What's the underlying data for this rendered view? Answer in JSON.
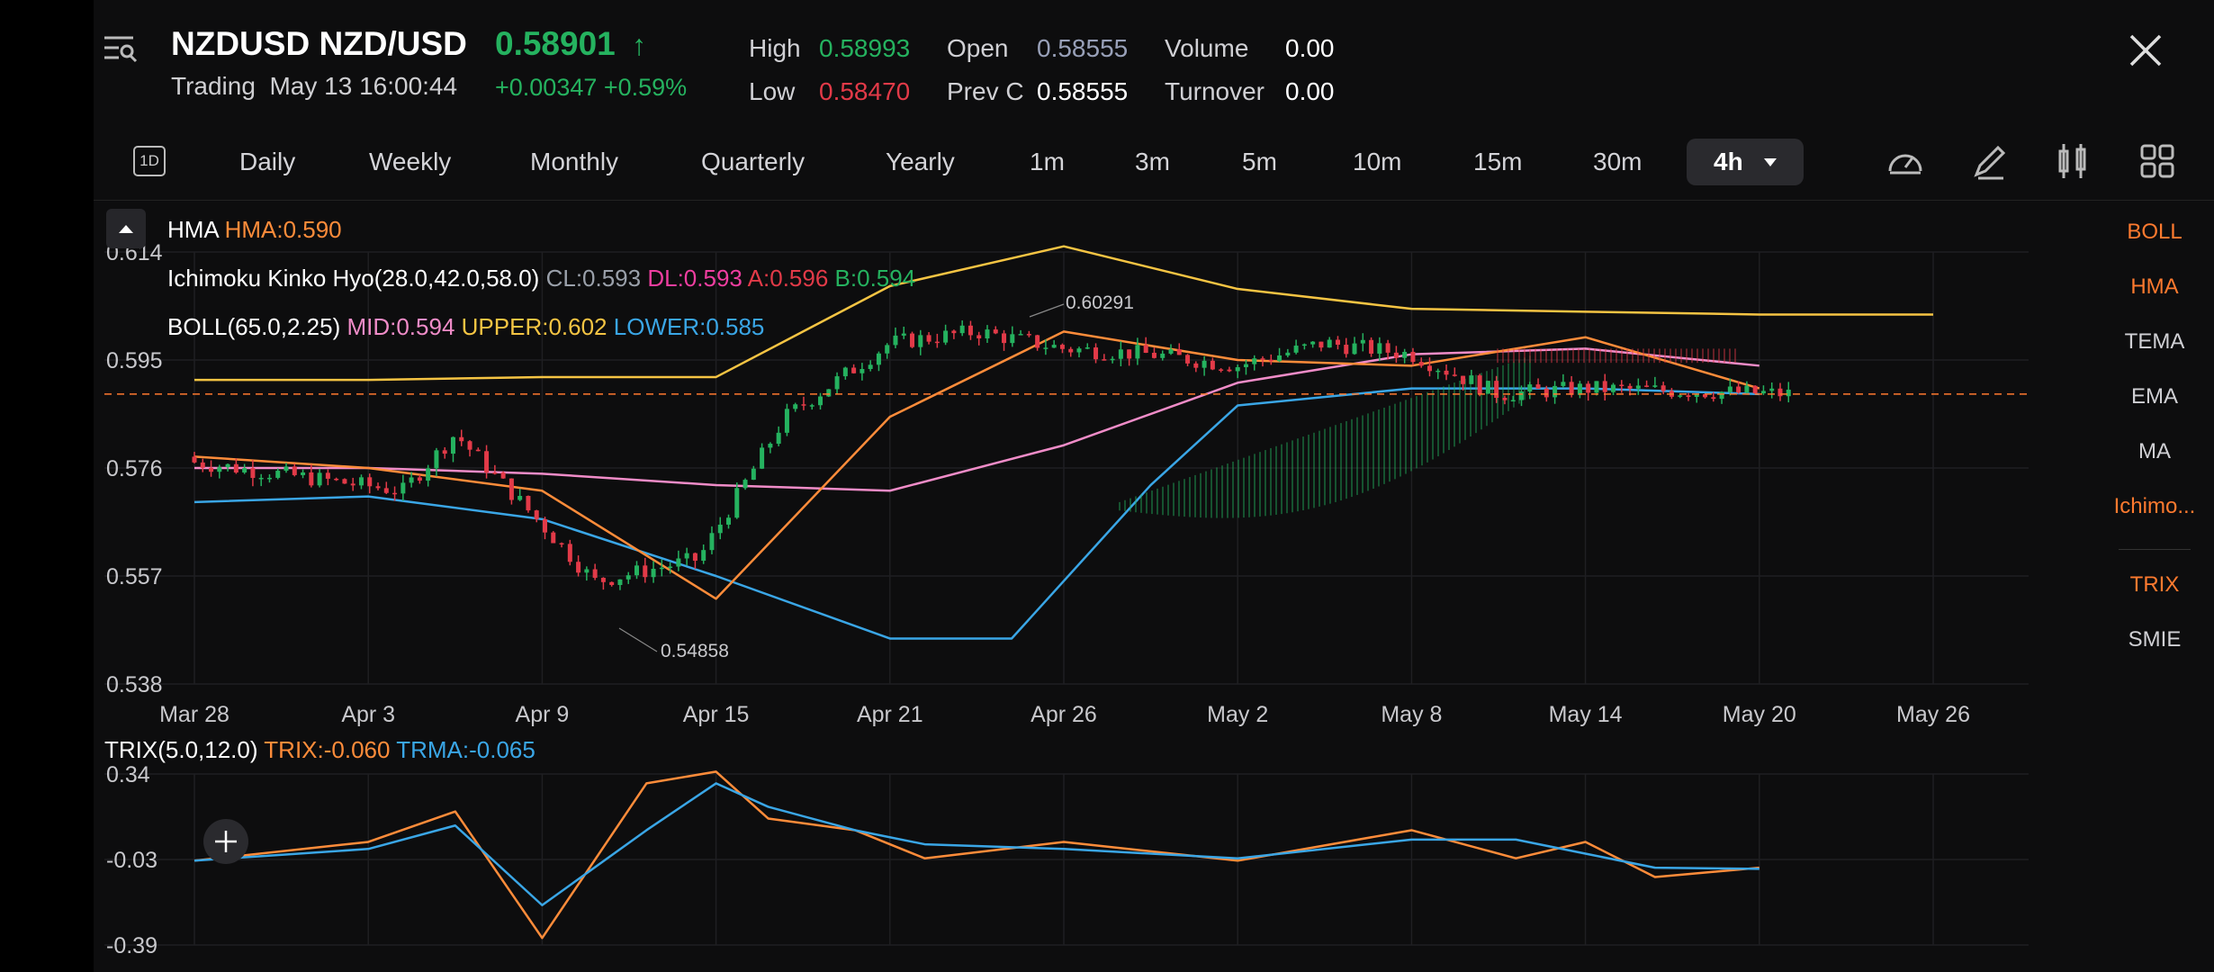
{
  "header": {
    "symbol": "NZDUSD NZD/USD",
    "price": "0.58901",
    "price_arrow": "↑",
    "status": "Trading",
    "timestamp": "May 13 16:00:44",
    "change": "+0.00347 +0.59%",
    "stats": {
      "high_label": "High",
      "high": "0.58993",
      "open_label": "Open",
      "open": "0.58555",
      "volume_label": "Volume",
      "volume": "0.00",
      "low_label": "Low",
      "low": "0.58470",
      "prevc_label": "Prev C",
      "prevc": "0.58555",
      "turnover_label": "Turnover",
      "turnover": "0.00"
    }
  },
  "tabs": {
    "icon_1d": "1D",
    "items": [
      "Daily",
      "Weekly",
      "Monthly",
      "Quarterly",
      "Yearly",
      "1m",
      "3m",
      "5m",
      "10m",
      "15m",
      "30m"
    ],
    "active": "4h"
  },
  "colors": {
    "up": "#25b25f",
    "down": "#e23a48",
    "accent": "#ff7a2f",
    "background": "#0d0d0e"
  },
  "icons": [
    "menu-search-icon",
    "close-icon",
    "chevron-up-icon",
    "speedometer-icon",
    "pencil-icon",
    "candlestick-icon",
    "grid-icon",
    "crosshair-icon"
  ],
  "legends": {
    "hma": {
      "name": "HMA",
      "value": "HMA:0.590"
    },
    "ichimoku": {
      "name": "Ichimoku Kinko Hyo(28.0,42.0,58.0)",
      "cl": "CL:0.593",
      "dl": "DL:0.593",
      "a": "A:0.596",
      "b": "B:0.594"
    },
    "boll": {
      "name": "BOLL(65.0,2.25)",
      "mid": "MID:0.594",
      "upper": "UPPER:0.602",
      "lower": "LOWER:0.585"
    },
    "trix": {
      "name": "TRIX(5.0,12.0)",
      "trix": "TRIX:-0.060",
      "trma": "TRMA:-0.065"
    }
  },
  "side_indicators": {
    "main": [
      "BOLL",
      "HMA",
      "TEMA",
      "EMA",
      "MA",
      "Ichimo..."
    ],
    "sub": [
      "TRIX",
      "SMIE"
    ],
    "active": [
      "BOLL",
      "HMA",
      "Ichimo...",
      "TRIX"
    ]
  },
  "chart_data": [
    {
      "type": "line",
      "title": "",
      "y_ticks": [
        "0.614",
        "0.595",
        "0.576",
        "0.557",
        "0.538"
      ],
      "ylim": [
        0.538,
        0.614
      ],
      "x_ticks": [
        "Mar 28",
        "Apr 3",
        "Apr 9",
        "Apr 15",
        "Apr 21",
        "Apr 26",
        "May 2",
        "May 8",
        "May 14",
        "May 20",
        "May 26"
      ],
      "annotations": [
        "0.60291",
        "0.54858"
      ],
      "current_price": 0.58901,
      "grid": true,
      "series": [
        {
          "name": "BOLL UPPER",
          "color": "#f5c443",
          "x": [
            0,
            1,
            2,
            3,
            4,
            5,
            6,
            7,
            8,
            9,
            10
          ],
          "values": [
            0.5915,
            0.5915,
            0.592,
            0.592,
            0.608,
            0.615,
            0.6075,
            0.604,
            0.6035,
            0.603,
            0.603
          ]
        },
        {
          "name": "BOLL LOWER",
          "color": "#3aa6e6",
          "x": [
            0,
            1,
            2,
            3,
            4,
            4.7,
            5.5,
            6,
            7,
            8,
            9
          ],
          "values": [
            0.57,
            0.571,
            0.567,
            0.557,
            0.546,
            0.546,
            0.573,
            0.587,
            0.59,
            0.59,
            0.589
          ]
        },
        {
          "name": "BOLL MID",
          "color": "#f08cc8",
          "x": [
            0,
            1,
            2,
            3,
            4,
            5,
            6,
            7,
            8,
            9
          ],
          "values": [
            0.576,
            0.576,
            0.575,
            0.573,
            0.572,
            0.58,
            0.591,
            0.596,
            0.597,
            0.594
          ]
        },
        {
          "name": "HMA",
          "color": "#ff8c3a",
          "x": [
            0,
            1,
            2,
            3,
            4,
            5,
            6,
            7,
            8,
            9
          ],
          "values": [
            0.578,
            0.576,
            0.572,
            0.553,
            0.585,
            0.6,
            0.595,
            0.594,
            0.599,
            0.59
          ]
        }
      ]
    },
    {
      "type": "line",
      "title": "",
      "y_ticks": [
        "0.34",
        "-0.03",
        "-0.39"
      ],
      "ylim": [
        -0.39,
        0.34
      ],
      "series": [
        {
          "name": "TRIX",
          "color": "#ff8c3a",
          "x": [
            0,
            1,
            1.5,
            2,
            2.6,
            3,
            3.3,
            3.8,
            4.2,
            5,
            6,
            7,
            7.6,
            8,
            8.4,
            9
          ],
          "values": [
            -0.03,
            0.05,
            0.18,
            -0.36,
            0.3,
            0.35,
            0.15,
            0.1,
            -0.02,
            0.05,
            -0.03,
            0.1,
            -0.02,
            0.05,
            -0.1,
            -0.06
          ]
        },
        {
          "name": "TRMA",
          "color": "#3aa6e6",
          "x": [
            0,
            1,
            1.5,
            2,
            2.6,
            3,
            3.3,
            3.8,
            4.2,
            5,
            6,
            7,
            7.6,
            8,
            8.4,
            9
          ],
          "values": [
            -0.03,
            0.02,
            0.12,
            -0.22,
            0.1,
            0.3,
            0.2,
            0.1,
            0.04,
            0.02,
            -0.02,
            0.06,
            0.06,
            0.0,
            -0.06,
            -0.065
          ]
        }
      ]
    }
  ]
}
